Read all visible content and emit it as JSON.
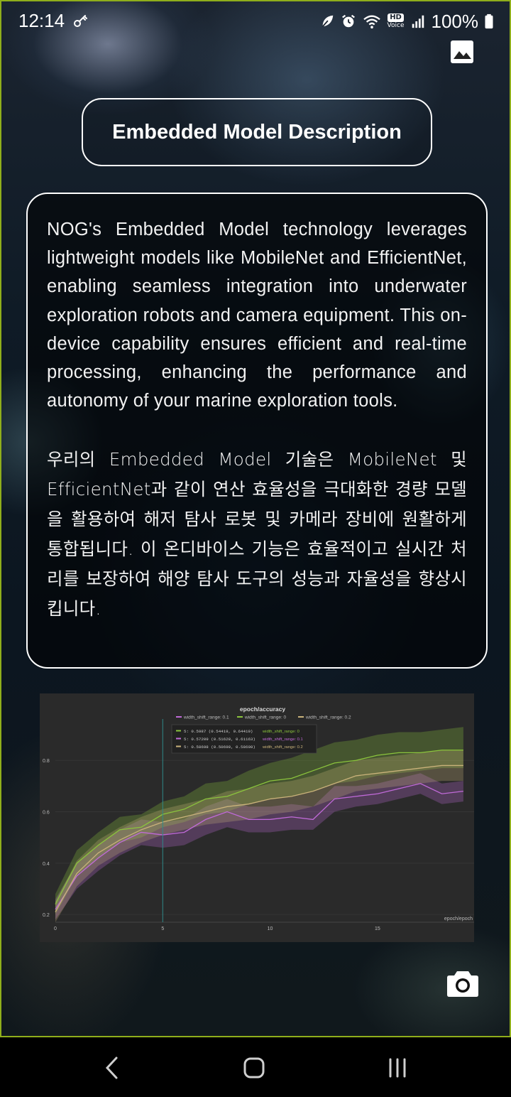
{
  "status_bar": {
    "time": "12:14",
    "battery": "100%",
    "icons": [
      "key-icon",
      "leaf-icon",
      "alarm-icon",
      "wifi-icon",
      "hd-voice-icon",
      "signal-icon",
      "battery-icon"
    ],
    "hd_label": "HD",
    "voice_label": "Voice"
  },
  "header": {
    "gallery_icon": "gallery-icon"
  },
  "title": "Embedded Model Description",
  "description": {
    "en": "NOG's Embedded Model technology leverages lightweight models like MobileNet and EfficientNet, enabling seamless integration into underwater exploration robots and camera equipment. This on-device capability ensures efficient and real-time processing, enhancing the performance and autonomy of your marine exploration tools.",
    "ko": "우리의 Embedded Model 기술은 MobileNet 및 EfficientNet과 같이 연산 효율성을 극대화한 경량 모델을 활용하여 해저 탐사 로봇 및 카메라 장비에 원활하게 통합됩니다. 이 온디바이스 기능은 효율적이고 실시간 처리를 보장하여 해양 탐사 도구의 성능과 자율성을 향상시킵니다."
  },
  "chart_data": {
    "type": "line",
    "title": "epoch/accuracy",
    "xlabel": "epoch/epoch",
    "ylabel": "",
    "xlim": [
      0,
      19.5
    ],
    "ylim": [
      0.17,
      0.95
    ],
    "xticks": [
      "0",
      "5",
      "10",
      "15"
    ],
    "yticks": [
      "0.2",
      "0.4",
      "0.6",
      "0.8"
    ],
    "legend_position": "top",
    "cursor_x": 5,
    "tooltip": [
      {
        "text": "5:  0.5987  (0.54419, 0.64419)",
        "series": "width_shift_range: 0"
      },
      {
        "text": "5:  0.57209  (0.51628, 0.61163)",
        "series": "width_shift_range: 0.1"
      },
      {
        "text": "5:  0.58698  (0.50698, 0.58698)",
        "series": "width_shift_range: 0.2"
      }
    ],
    "series": [
      {
        "name": "width_shift_range: 0.1",
        "color": "#c06ad8",
        "x": [
          0,
          1,
          2,
          3,
          4,
          5,
          6,
          7,
          8,
          9,
          10,
          11,
          12,
          13,
          14,
          15,
          16,
          17,
          18,
          19
        ],
        "values": [
          0.22,
          0.35,
          0.42,
          0.48,
          0.52,
          0.51,
          0.52,
          0.57,
          0.6,
          0.57,
          0.57,
          0.58,
          0.57,
          0.65,
          0.66,
          0.67,
          0.69,
          0.71,
          0.67,
          0.68
        ],
        "band_lo": [
          0.18,
          0.3,
          0.37,
          0.43,
          0.47,
          0.46,
          0.47,
          0.51,
          0.54,
          0.52,
          0.52,
          0.53,
          0.53,
          0.6,
          0.62,
          0.63,
          0.65,
          0.67,
          0.63,
          0.64
        ],
        "band_hi": [
          0.26,
          0.4,
          0.47,
          0.53,
          0.57,
          0.56,
          0.57,
          0.62,
          0.65,
          0.62,
          0.62,
          0.63,
          0.62,
          0.7,
          0.7,
          0.71,
          0.73,
          0.75,
          0.71,
          0.72
        ]
      },
      {
        "name": "width_shift_range: 0",
        "color": "#8bc43d",
        "x": [
          0,
          1,
          2,
          3,
          4,
          5,
          6,
          7,
          8,
          9,
          10,
          11,
          12,
          13,
          14,
          15,
          16,
          17,
          18,
          19
        ],
        "values": [
          0.24,
          0.4,
          0.47,
          0.53,
          0.54,
          0.59,
          0.61,
          0.65,
          0.66,
          0.69,
          0.72,
          0.73,
          0.76,
          0.79,
          0.8,
          0.82,
          0.83,
          0.83,
          0.84,
          0.84
        ],
        "band_lo": [
          0.2,
          0.35,
          0.42,
          0.48,
          0.5,
          0.54,
          0.56,
          0.59,
          0.6,
          0.63,
          0.65,
          0.66,
          0.68,
          0.71,
          0.72,
          0.74,
          0.75,
          0.76,
          0.77,
          0.77
        ],
        "band_hi": [
          0.28,
          0.45,
          0.52,
          0.58,
          0.59,
          0.64,
          0.66,
          0.71,
          0.72,
          0.76,
          0.79,
          0.81,
          0.84,
          0.87,
          0.88,
          0.9,
          0.91,
          0.91,
          0.92,
          0.93
        ]
      },
      {
        "name": "width_shift_range: 0.2",
        "color": "#c9b27a",
        "x": [
          0,
          1,
          2,
          3,
          4,
          5,
          6,
          7,
          8,
          9,
          10,
          11,
          12,
          13,
          14,
          15,
          16,
          17,
          18,
          19
        ],
        "values": [
          0.21,
          0.36,
          0.44,
          0.49,
          0.53,
          0.56,
          0.58,
          0.6,
          0.62,
          0.63,
          0.65,
          0.66,
          0.68,
          0.71,
          0.74,
          0.75,
          0.76,
          0.77,
          0.78,
          0.78
        ],
        "band_lo": [
          0.17,
          0.31,
          0.39,
          0.44,
          0.48,
          0.51,
          0.53,
          0.55,
          0.56,
          0.57,
          0.59,
          0.6,
          0.62,
          0.65,
          0.68,
          0.69,
          0.7,
          0.71,
          0.72,
          0.72
        ],
        "band_hi": [
          0.25,
          0.41,
          0.49,
          0.54,
          0.58,
          0.61,
          0.63,
          0.65,
          0.68,
          0.69,
          0.71,
          0.72,
          0.74,
          0.77,
          0.8,
          0.81,
          0.82,
          0.83,
          0.84,
          0.84
        ]
      }
    ]
  },
  "camera_button_icon": "camera-icon",
  "nav": {
    "back_icon": "back-icon",
    "home_icon": "home-icon",
    "recents_icon": "recents-icon"
  }
}
